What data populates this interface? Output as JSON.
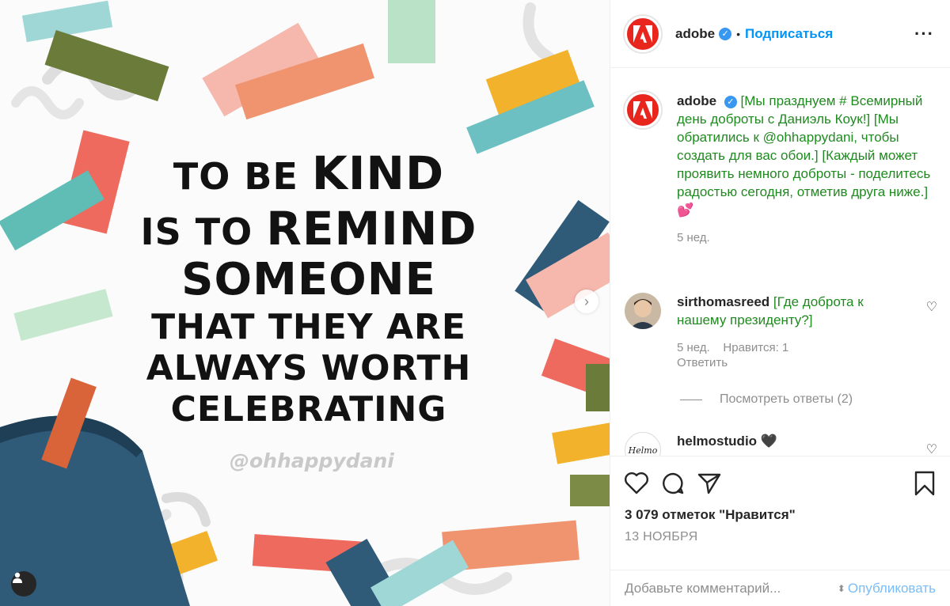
{
  "post": {
    "image": {
      "quote_lines": [
        "TO BE",
        "KIND",
        "IS TO",
        "REMIND",
        "SOMEONE",
        "THAT THEY ARE",
        "ALWAYS WORTH",
        "CELEBRATING"
      ],
      "watermark": "@ohhappydani"
    },
    "header": {
      "username": "adobe",
      "verified_icon": "verified-badge-icon",
      "dot": "•",
      "follow_label": "Подписаться",
      "more_label": "···"
    },
    "caption": {
      "username": "adobe",
      "text": "[Мы празднуем # Всемирный день доброты с Даниэль Коук!] [Мы обратились к @ohhappydani, чтобы создать для вас обои.] [Каждый может проявить немного доброты - поделитесь радостью сегодня, отметив друга ниже.] 💕",
      "time": "5 нед."
    },
    "comments": [
      {
        "username": "sirthomasreed",
        "text": "[Где доброта к нашему президенту?]",
        "time": "5 нед.",
        "likes": "Нравится: 1",
        "reply": "Ответить",
        "view_replies": "Посмотреть ответы (2)"
      },
      {
        "username": "helmostudio",
        "text": "🖤",
        "avatar_text": "Helmo"
      }
    ],
    "likes_count": "3 079 отметок \"Нравится\"",
    "date": "13 НОЯБРЯ",
    "add_comment_placeholder": "Добавьте комментарий...",
    "publish_label": "Опубликовать"
  },
  "colors": {
    "brand_red": "#e8261d",
    "link_blue": "#0095f6",
    "translated_green": "#1f8a1f"
  }
}
